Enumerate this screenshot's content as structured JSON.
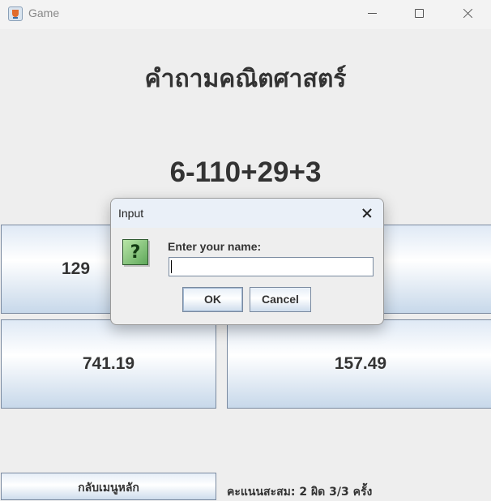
{
  "window": {
    "title": "Game",
    "icon": "java-cup-icon"
  },
  "main": {
    "heading": "คำถามคณิตศาสตร์",
    "question": "6-110+29+3",
    "answers": [
      "129",
      "",
      "741.19",
      "157.49"
    ],
    "back_label": "กลับเมนูหลัก",
    "score_text": "คะแนนสะสม: 2 ผิด 3/3 ครั้ง"
  },
  "dialog": {
    "title": "Input",
    "prompt": "Enter your name:",
    "input_value": "",
    "ok_label": "OK",
    "cancel_label": "Cancel",
    "icon": "question-icon",
    "icon_glyph": "?"
  }
}
